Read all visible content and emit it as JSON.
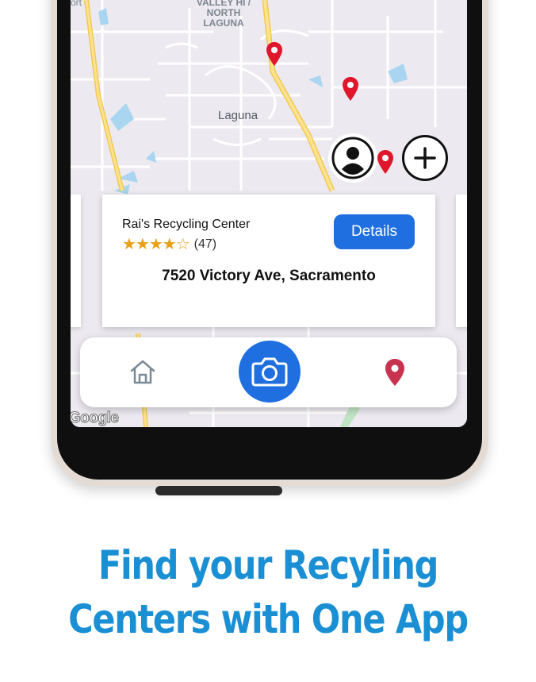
{
  "map": {
    "labels": {
      "valley": "VALLEY HI / NORTH LAGUNA",
      "laguna": "Laguna",
      "fort": "ort",
      "google": "Google"
    },
    "pin_color": "#e0172c",
    "pin_count": 3
  },
  "map_actions": {
    "profile_icon": "profile-icon",
    "add_icon": "plus-icon"
  },
  "card": {
    "name": "Rai's Recycling Center",
    "stars": "★★★★☆",
    "rating_count": "(47)",
    "rating_value": 4,
    "details_label": "Details",
    "address": "7520 Victory Ave, Sacramento"
  },
  "bottom_nav": {
    "items": [
      {
        "icon": "home-icon"
      },
      {
        "icon": "camera-icon"
      },
      {
        "icon": "location-pin-icon"
      }
    ]
  },
  "headline": {
    "line1": "Find your Recyling",
    "line2": "Centers with One App"
  },
  "colors": {
    "accent": "#1f6fe0",
    "headline": "#1a8fd4",
    "star": "#e8a019",
    "pin": "#e0172c"
  }
}
